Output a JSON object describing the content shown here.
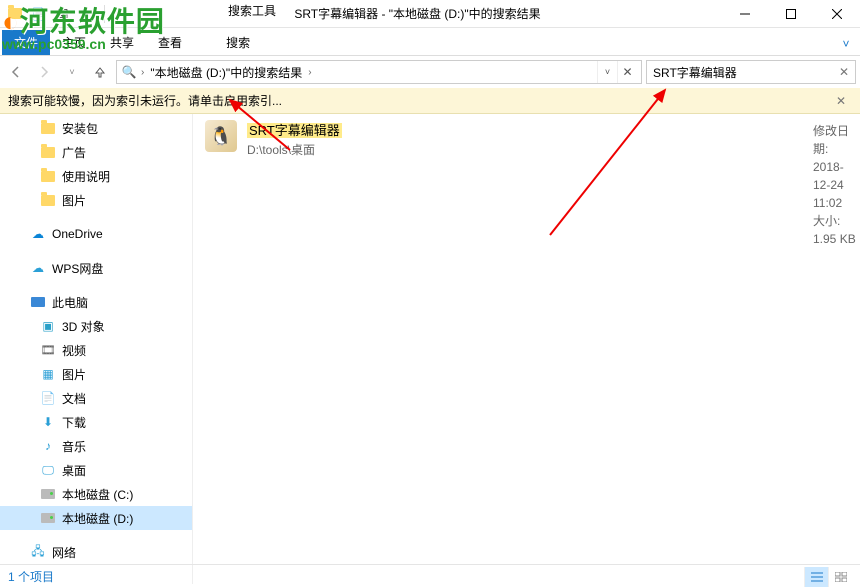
{
  "window": {
    "title": "SRT字幕编辑器 - \"本地磁盘 (D:)\"中的搜索结果",
    "search_tools_label": "搜索工具",
    "search_tools_tab": "搜索"
  },
  "ribbon": {
    "file": "文件",
    "tabs": [
      "主页",
      "共享",
      "查看"
    ]
  },
  "address": {
    "crumb": "\"本地磁盘 (D:)\"中的搜索结果",
    "search_value": "SRT字幕编辑器"
  },
  "infobar": {
    "message": "搜索可能较慢，因为索引未运行。请单击启用索引..."
  },
  "sidebar": {
    "items": [
      {
        "label": "安装包",
        "type": "folder",
        "depth": 2
      },
      {
        "label": "广告",
        "type": "folder",
        "depth": 2
      },
      {
        "label": "使用说明",
        "type": "folder",
        "depth": 2
      },
      {
        "label": "图片",
        "type": "folder",
        "depth": 2
      },
      {
        "label": "OneDrive",
        "type": "onedrive",
        "depth": 1,
        "spaced": true
      },
      {
        "label": "WPS网盘",
        "type": "wps",
        "depth": 1,
        "spaced": true
      },
      {
        "label": "此电脑",
        "type": "pc",
        "depth": 1,
        "spaced": true
      },
      {
        "label": "3D 对象",
        "type": "3d",
        "depth": 2
      },
      {
        "label": "视频",
        "type": "video",
        "depth": 2
      },
      {
        "label": "图片",
        "type": "pics",
        "depth": 2
      },
      {
        "label": "文档",
        "type": "docs",
        "depth": 2
      },
      {
        "label": "下载",
        "type": "download",
        "depth": 2
      },
      {
        "label": "音乐",
        "type": "music",
        "depth": 2
      },
      {
        "label": "桌面",
        "type": "desktop",
        "depth": 2
      },
      {
        "label": "本地磁盘 (C:)",
        "type": "drive",
        "depth": 2
      },
      {
        "label": "本地磁盘 (D:)",
        "type": "drive",
        "depth": 2,
        "selected": true
      },
      {
        "label": "网络",
        "type": "network",
        "depth": 1,
        "spaced": true
      }
    ]
  },
  "result": {
    "name": "SRT字幕编辑器",
    "path": "D:\\tools\\桌面",
    "date_label": "修改日期:",
    "date_value": "2018-12-24 11:02",
    "size_label": "大小:",
    "size_value": "1.95 KB"
  },
  "status": {
    "count": "1 个项目"
  },
  "watermark": {
    "site": "河东软件园",
    "url": "www.pc0359.cn"
  }
}
